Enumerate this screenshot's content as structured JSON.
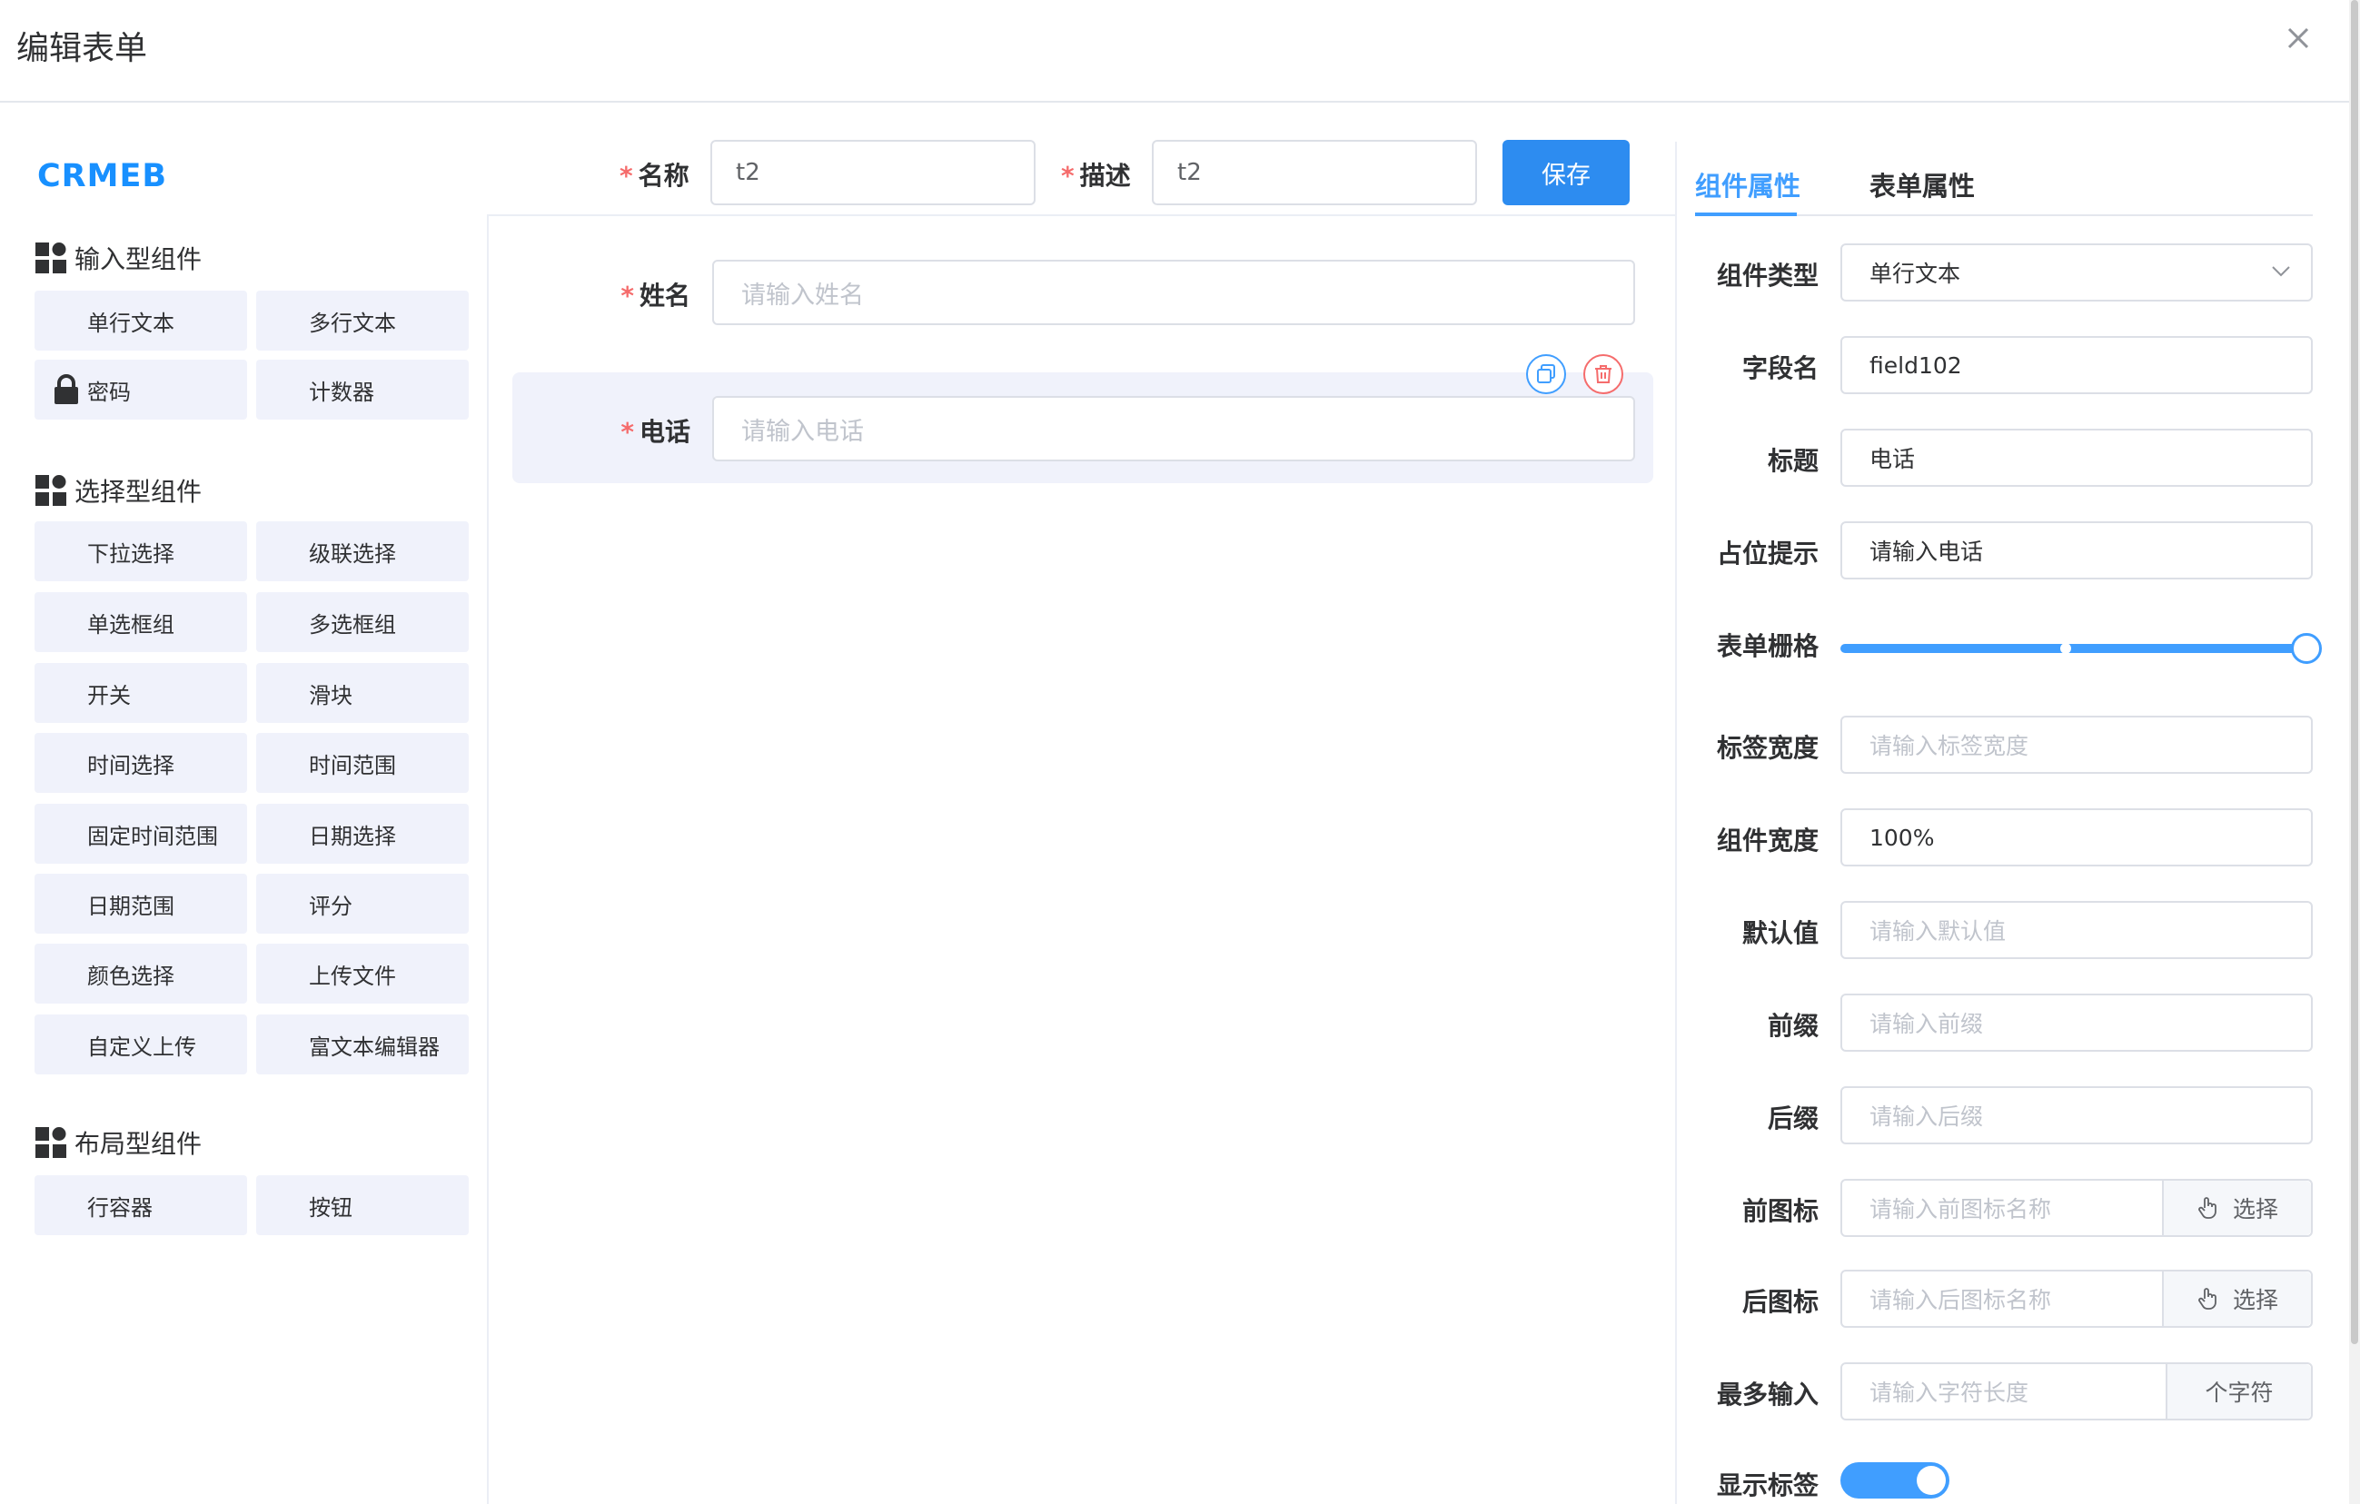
{
  "dialog": {
    "title": "编辑表单"
  },
  "logo": "CRMEB",
  "palette": {
    "input_group": {
      "title": "输入型组件",
      "items": [
        "单行文本",
        "多行文本",
        "密码",
        "计数器"
      ]
    },
    "select_group": {
      "title": "选择型组件",
      "items": [
        "下拉选择",
        "级联选择",
        "单选框组",
        "多选框组",
        "开关",
        "滑块",
        "时间选择",
        "时间范围",
        "固定时间范围",
        "日期选择",
        "日期范围",
        "评分",
        "颜色选择",
        "上传文件",
        "自定义上传",
        "富文本编辑器"
      ]
    },
    "layout_group": {
      "title": "布局型组件",
      "items": [
        "行容器",
        "按钮"
      ]
    }
  },
  "form_header": {
    "required_mark": "*",
    "name_label": "名称",
    "name_value": "t2",
    "desc_label": "描述",
    "desc_value": "t2",
    "save_label": "保存"
  },
  "canvas": {
    "fields": [
      {
        "label": "姓名",
        "placeholder": "请输入姓名"
      },
      {
        "label": "电话",
        "placeholder": "请输入电话"
      }
    ]
  },
  "tabs": {
    "component": "组件属性",
    "form": "表单属性"
  },
  "props": {
    "type": {
      "label": "组件类型",
      "value": "单行文本"
    },
    "field_name": {
      "label": "字段名",
      "value": "field102"
    },
    "title": {
      "label": "标题",
      "value": "电话"
    },
    "placeholder": {
      "label": "占位提示",
      "value": "请输入电话"
    },
    "grid": {
      "label": "表单栅格",
      "value": 24,
      "max": 24
    },
    "label_width": {
      "label": "标签宽度",
      "placeholder": "请输入标签宽度"
    },
    "comp_width": {
      "label": "组件宽度",
      "value": "100%"
    },
    "default": {
      "label": "默认值",
      "placeholder": "请输入默认值"
    },
    "prefix": {
      "label": "前缀",
      "placeholder": "请输入前缀"
    },
    "suffix": {
      "label": "后缀",
      "placeholder": "请输入后缀"
    },
    "prefix_icon": {
      "label": "前图标",
      "placeholder": "请输入前图标名称",
      "button": "选择"
    },
    "suffix_icon": {
      "label": "后图标",
      "placeholder": "请输入后图标名称",
      "button": "选择"
    },
    "max_length": {
      "label": "最多输入",
      "placeholder": "请输入字符长度",
      "addon": "个字符"
    },
    "show_label": {
      "label": "显示标签",
      "on": true
    }
  },
  "colors": {
    "primary": "#409eff",
    "brand": "#1890ff",
    "danger": "#f56c6c",
    "button": "#2d8cf0"
  }
}
